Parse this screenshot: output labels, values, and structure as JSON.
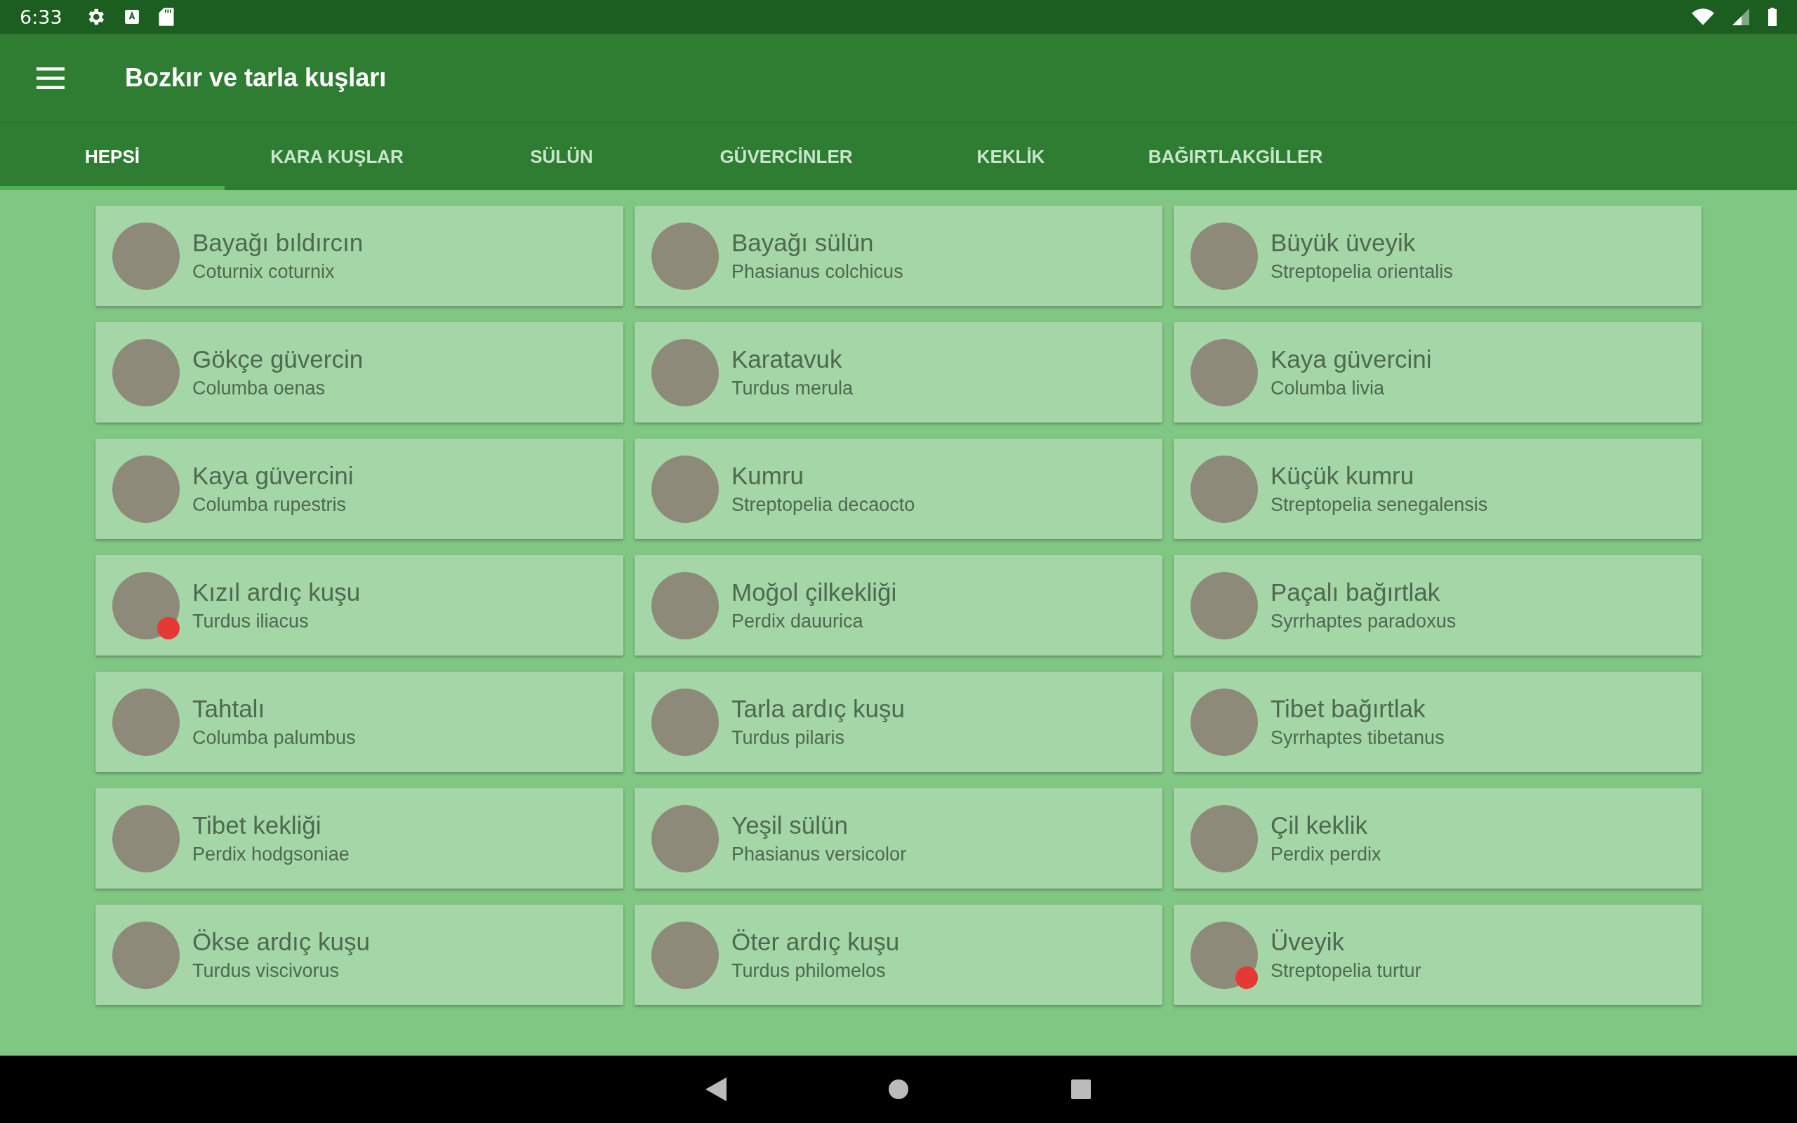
{
  "status_bar": {
    "time": "6:33"
  },
  "app_bar": {
    "title": "Bozkır ve tarla kuşları"
  },
  "tabs": [
    {
      "label": "HEPSİ",
      "selected": true
    },
    {
      "label": "KARA KUŞLAR",
      "selected": false
    },
    {
      "label": "SÜLÜN",
      "selected": false
    },
    {
      "label": "GÜVERCİNLER",
      "selected": false
    },
    {
      "label": "KEKLİK",
      "selected": false
    },
    {
      "label": "BAĞIRTLAKGİLLER",
      "selected": false
    }
  ],
  "birds": [
    {
      "name": "Bayağı bıldırcın",
      "latin": "Coturnix coturnix",
      "flagged": false
    },
    {
      "name": "Bayağı sülün",
      "latin": "Phasianus colchicus",
      "flagged": false
    },
    {
      "name": "Büyük üveyik",
      "latin": "Streptopelia orientalis",
      "flagged": false
    },
    {
      "name": "Gökçe güvercin",
      "latin": "Columba oenas",
      "flagged": false
    },
    {
      "name": "Karatavuk",
      "latin": "Turdus merula",
      "flagged": false
    },
    {
      "name": "Kaya güvercini",
      "latin": "Columba livia",
      "flagged": false
    },
    {
      "name": "Kaya güvercini",
      "latin": "Columba rupestris",
      "flagged": false
    },
    {
      "name": "Kumru",
      "latin": "Streptopelia decaocto",
      "flagged": false
    },
    {
      "name": "Küçük kumru",
      "latin": "Streptopelia senegalensis",
      "flagged": false
    },
    {
      "name": "Kızıl ardıç kuşu",
      "latin": "Turdus iliacus",
      "flagged": true
    },
    {
      "name": "Moğol çilkekliği",
      "latin": "Perdix dauurica",
      "flagged": false
    },
    {
      "name": "Paçalı bağırtlak",
      "latin": "Syrrhaptes paradoxus",
      "flagged": false
    },
    {
      "name": "Tahtalı",
      "latin": "Columba palumbus",
      "flagged": false
    },
    {
      "name": "Tarla ardıç kuşu",
      "latin": "Turdus pilaris",
      "flagged": false
    },
    {
      "name": "Tibet bağırtlak",
      "latin": "Syrrhaptes tibetanus",
      "flagged": false
    },
    {
      "name": "Tibet kekliği",
      "latin": "Perdix hodgsoniae",
      "flagged": false
    },
    {
      "name": "Yeşil sülün",
      "latin": "Phasianus versicolor",
      "flagged": false
    },
    {
      "name": "Çil keklik",
      "latin": "Perdix perdix",
      "flagged": false
    },
    {
      "name": "Ökse ardıç kuşu",
      "latin": "Turdus viscivorus",
      "flagged": false
    },
    {
      "name": "Öter ardıç kuşu",
      "latin": "Turdus philomelos",
      "flagged": false
    },
    {
      "name": "Üveyik",
      "latin": "Streptopelia turtur",
      "flagged": true
    }
  ]
}
